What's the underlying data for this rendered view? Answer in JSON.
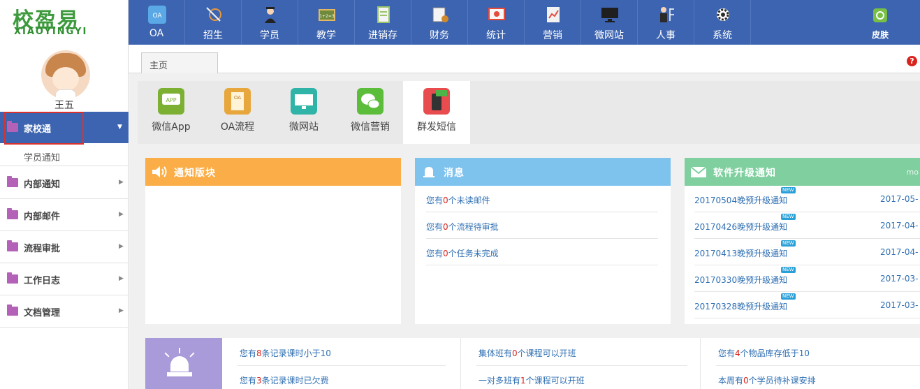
{
  "logo": {
    "cn": "校盈易",
    "en": "XIAOYINGYI"
  },
  "topnav": [
    {
      "label": "OA",
      "icon": "oa-icon",
      "color": "#5aa9e6"
    },
    {
      "label": "招生",
      "icon": "enroll-icon",
      "color": "#e9973a"
    },
    {
      "label": "学员",
      "icon": "student-icon",
      "color": "#2d2d2d"
    },
    {
      "label": "教学",
      "icon": "blackboard-icon",
      "color": "#6e8a3a"
    },
    {
      "label": "进销存",
      "icon": "inventory-icon",
      "color": "#9bc46a"
    },
    {
      "label": "财务",
      "icon": "finance-icon",
      "color": "#d08a2b"
    },
    {
      "label": "统计",
      "icon": "stats-icon",
      "color": "#e64b3c"
    },
    {
      "label": "营销",
      "icon": "marketing-icon",
      "color": "#f2f2f2"
    },
    {
      "label": "微网站",
      "icon": "monitor-icon",
      "color": "#1f1f1f"
    },
    {
      "label": "人事",
      "icon": "person-icon",
      "color": "#2a2a2a"
    },
    {
      "label": "系统",
      "icon": "gear-icon",
      "color": "#2b2b2b"
    }
  ],
  "skin_label": "皮肤",
  "user": {
    "name": "王五"
  },
  "sidebar": {
    "active": {
      "label": "家校通"
    },
    "sub": [
      {
        "label": "学员通知"
      }
    ],
    "items": [
      {
        "label": "内部通知"
      },
      {
        "label": "内部邮件"
      },
      {
        "label": "流程审批"
      },
      {
        "label": "工作日志"
      },
      {
        "label": "文档管理"
      }
    ]
  },
  "tabs": [
    {
      "label": "主页"
    }
  ],
  "help_label": "?",
  "quick": [
    {
      "label": "微信App",
      "icon": "app-icon",
      "color": "#7bb033"
    },
    {
      "label": "OA流程",
      "icon": "oa-flow-icon",
      "color": "#e7a73c"
    },
    {
      "label": "微网站",
      "icon": "microsite-icon",
      "color": "#2fb4a7"
    },
    {
      "label": "微信营销",
      "icon": "wechat-icon",
      "color": "#5cbd3a"
    },
    {
      "label": "群发短信",
      "icon": "sms-icon",
      "color": "#e84c4f"
    }
  ],
  "panels": {
    "notice": {
      "title": "通知版块",
      "color": "#fbae48"
    },
    "message": {
      "title": "消息",
      "color": "#7ec2ee",
      "rows": [
        {
          "pre": "您有",
          "num": "0",
          "post": "个未读邮件"
        },
        {
          "pre": "您有",
          "num": "0",
          "post": "个流程待审批"
        },
        {
          "pre": "您有",
          "num": "0",
          "post": "个任务未完成"
        }
      ]
    },
    "upgrade": {
      "title": "软件升级通知",
      "more": "mo",
      "color": "#7fcf9f",
      "new_label": "NEW",
      "rows": [
        {
          "title": "20170504晚预升级通知",
          "date": "2017-05-"
        },
        {
          "title": "20170426晚预升级通知",
          "date": "2017-04-"
        },
        {
          "title": "20170413晚预升级通知",
          "date": "2017-04-"
        },
        {
          "title": "20170330晚预升级通知",
          "date": "2017-03-"
        },
        {
          "title": "20170328晚预升级通知",
          "date": "2017-03-"
        }
      ]
    }
  },
  "alerts": [
    {
      "pre": "您有",
      "num": "8",
      "post": "条记录课时小于10"
    },
    {
      "pre": "您有",
      "num": "3",
      "post": "条记录课时已欠费"
    },
    {
      "pre": "集体班有",
      "num": "0",
      "post": "个课程可以开班"
    },
    {
      "pre": "一对多班有",
      "num": "1",
      "post": "个课程可以开班"
    },
    {
      "pre": "您有",
      "num": "4",
      "post": "个物品库存低于10"
    },
    {
      "pre": "本周有",
      "num": "0",
      "post": "个学员待补课安排"
    }
  ]
}
